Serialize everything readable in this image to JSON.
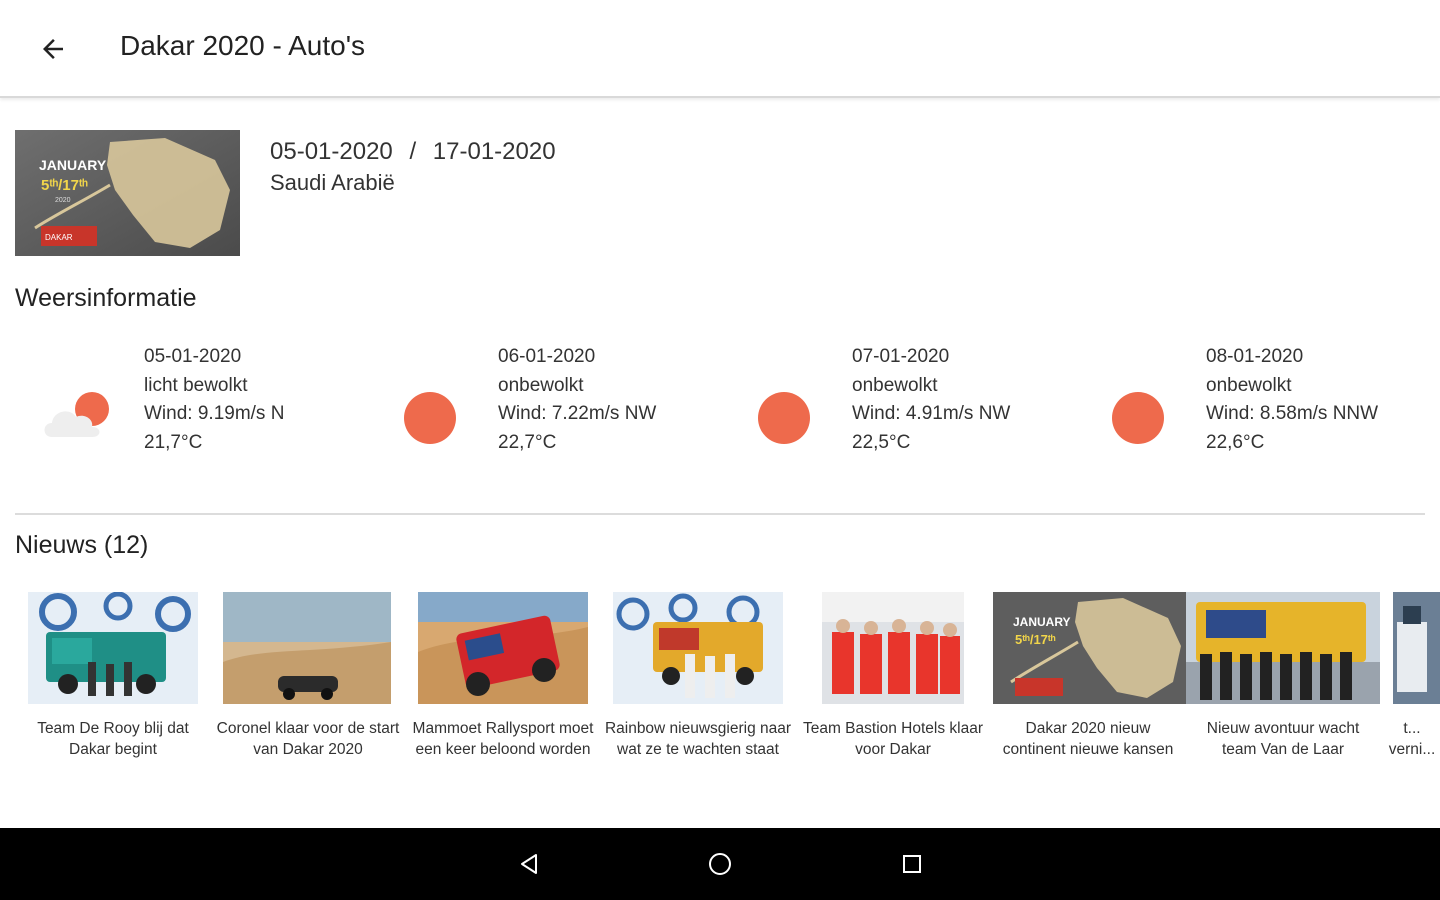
{
  "appbar": {
    "title": "Dakar 2020 - Auto's",
    "back_icon": "arrow-left-icon"
  },
  "event": {
    "start_date": "05-01-2020",
    "separator": "/",
    "end_date": "17-01-2020",
    "location": "Saudi Arabië",
    "thumbnail": {
      "line1": "JANUARY",
      "line2": "5ᵗʰ/17ᵗʰ",
      "line3": "2020",
      "badge": "DAKAR"
    }
  },
  "weather": {
    "title": "Weersinformatie",
    "days": [
      {
        "date": "05-01-2020",
        "condition": "licht bewolkt",
        "wind": "Wind: 9.19m/s  N",
        "temp": "21,7°C",
        "icon": "partly-cloudy-icon"
      },
      {
        "date": "06-01-2020",
        "condition": "onbewolkt",
        "wind": "Wind: 7.22m/s  NW",
        "temp": "22,7°C",
        "icon": "sun-icon"
      },
      {
        "date": "07-01-2020",
        "condition": "onbewolkt",
        "wind": "Wind: 4.91m/s  NW",
        "temp": "22,5°C",
        "icon": "sun-icon"
      },
      {
        "date": "08-01-2020",
        "condition": "onbewolkt",
        "wind": "Wind: 8.58m/s  NNW",
        "temp": "22,6°C",
        "icon": "sun-icon"
      }
    ]
  },
  "news": {
    "title": "Nieuws (12)",
    "items": [
      {
        "title": "Team De Rooy blij dat Dakar begint"
      },
      {
        "title": "Coronel klaar voor de start van Dakar 2020"
      },
      {
        "title": "Mammoet Rallysport moet een keer beloond worden"
      },
      {
        "title": "Rainbow nieuwsgierig naar wat ze te wachten staat"
      },
      {
        "title": "Team Bastion Hotels klaar voor Dakar"
      },
      {
        "title": "Dakar 2020 nieuw continent nieuwe kansen"
      },
      {
        "title": "Nieuw avontuur wacht team Van de Laar"
      },
      {
        "title": "t...\nverni..."
      }
    ]
  },
  "colors": {
    "accent": "#ee6a4c",
    "cloud": "#eeeeee",
    "navbar": "#000000"
  },
  "navbar": {
    "back": "nav-back-icon",
    "home": "nav-home-icon",
    "recents": "nav-recents-icon"
  }
}
